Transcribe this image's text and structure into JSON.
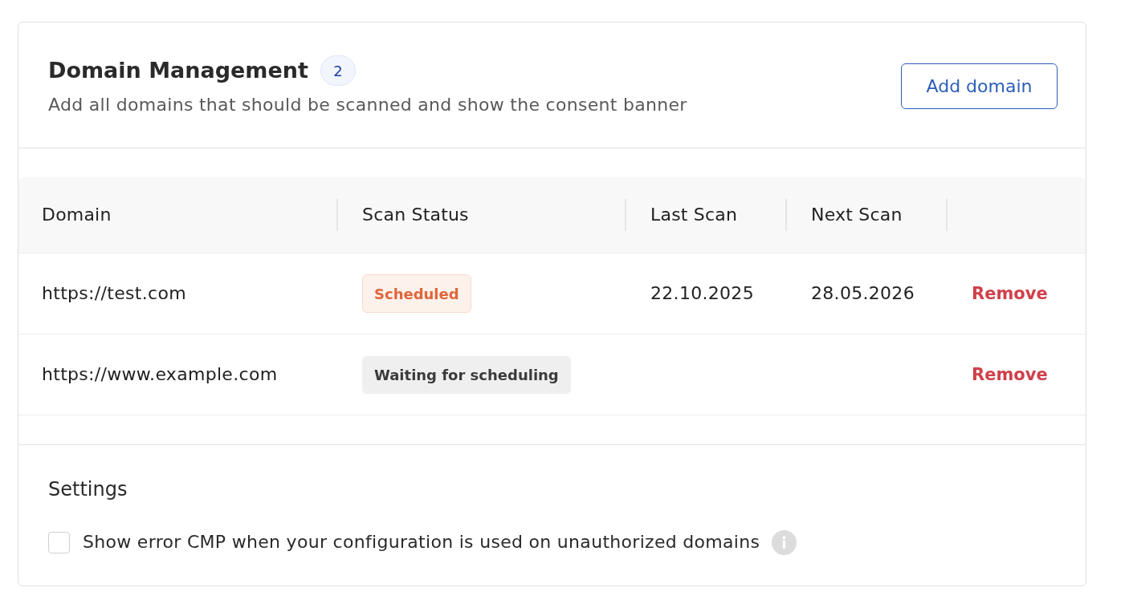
{
  "header": {
    "title": "Domain Management",
    "count": "2",
    "subtitle": "Add all domains that should be scanned and show the consent banner",
    "add_button": "Add domain"
  },
  "table": {
    "columns": [
      "Domain",
      "Scan Status",
      "Last Scan",
      "Next Scan"
    ],
    "rows": [
      {
        "domain": "https://test.com",
        "scan_status": {
          "label": "Scheduled",
          "kind": "scheduled"
        },
        "last_scan": "22.10.2025",
        "next_scan": "28.05.2026",
        "action": "Remove"
      },
      {
        "domain": "https://www.example.com",
        "scan_status": {
          "label": "Waiting for scheduling",
          "kind": "waiting"
        },
        "action": "Remove"
      }
    ]
  },
  "settings": {
    "title": "Settings",
    "options": [
      {
        "label": "Show error CMP when your configuration is used on unauthorized domains",
        "checked": false
      }
    ]
  }
}
